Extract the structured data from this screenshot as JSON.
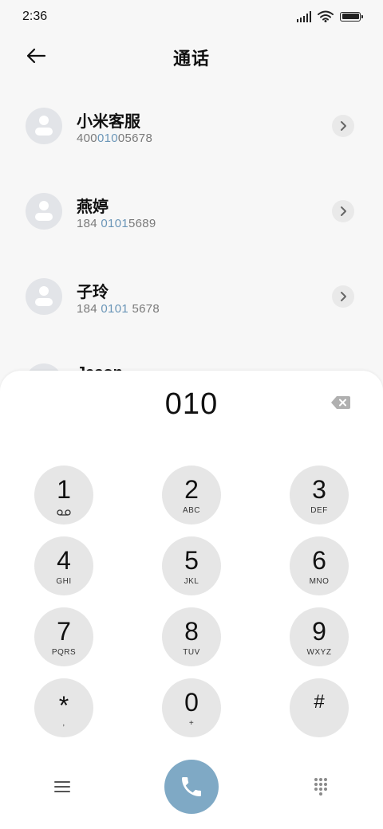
{
  "status_bar": {
    "time": "2:36",
    "battery_level_percent": 100
  },
  "header": {
    "title": "通话",
    "back_icon": "arrow-left-icon"
  },
  "contacts": [
    {
      "name": "小米客服",
      "number_pre": "400",
      "number_match": "010",
      "number_post": "05678"
    },
    {
      "name": "燕婷",
      "number_pre": "184 ",
      "number_match": "0101",
      "number_post": "5689"
    },
    {
      "name": "子玲",
      "number_pre": "184 ",
      "number_match": "0101",
      "number_post": " 5678"
    },
    {
      "name": "Jason",
      "number_pre": "",
      "number_match": "",
      "number_post": ""
    }
  ],
  "dialpad": {
    "dialed_number": "010",
    "keys": [
      {
        "digit": "1",
        "letters": "",
        "sub_icon": "voicemail-icon"
      },
      {
        "digit": "2",
        "letters": "ABC"
      },
      {
        "digit": "3",
        "letters": "DEF"
      },
      {
        "digit": "4",
        "letters": "GHI"
      },
      {
        "digit": "5",
        "letters": "JKL"
      },
      {
        "digit": "6",
        "letters": "MNO"
      },
      {
        "digit": "7",
        "letters": "PQRS"
      },
      {
        "digit": "8",
        "letters": "TUV"
      },
      {
        "digit": "9",
        "letters": "WXYZ"
      },
      {
        "digit": "*",
        "letters": ","
      },
      {
        "digit": "0",
        "letters": "+"
      },
      {
        "digit": "#",
        "letters": ""
      }
    ]
  },
  "colors": {
    "accent_call": "#7fa9c5",
    "match_highlight": "#6b96b8",
    "key_bg": "#e6e6e6"
  }
}
